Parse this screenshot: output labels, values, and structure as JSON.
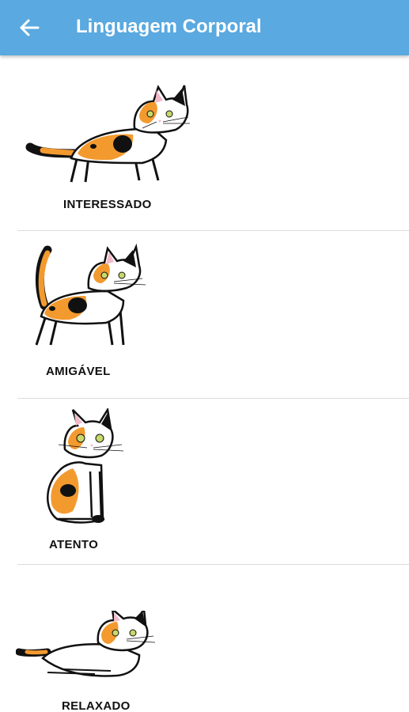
{
  "appbar": {
    "title": "Linguagem Corporal",
    "back_icon": "arrow-left-icon",
    "background": "#5aa9e0"
  },
  "postures": [
    {
      "label": "INTERESSADO",
      "image": "cat-interested-icon"
    },
    {
      "label": "AMIGÁVEL",
      "image": "cat-friendly-icon"
    },
    {
      "label": "ATENTO",
      "image": "cat-attentive-icon"
    },
    {
      "label": "RELAXADO",
      "image": "cat-relaxed-icon"
    }
  ],
  "colors": {
    "orange": "#f39a2f",
    "black": "#111111",
    "pink": "#f2b9c8",
    "eye": "#c8d86a"
  }
}
